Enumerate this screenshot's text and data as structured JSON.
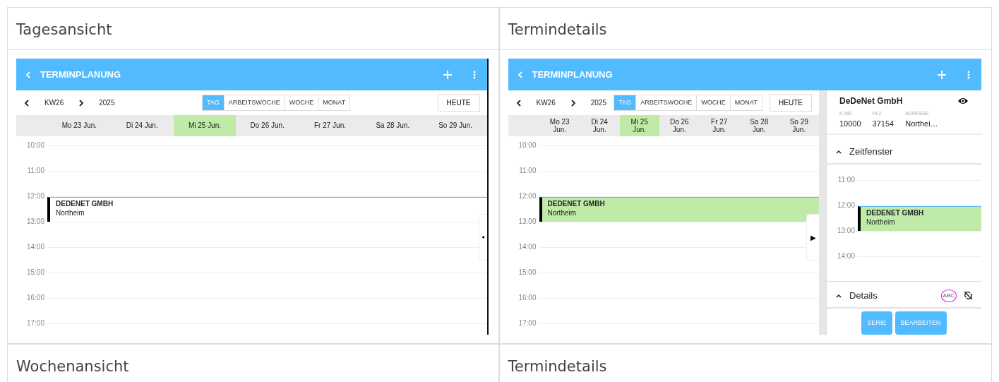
{
  "panels": [
    {
      "heading": "Tagesansicht",
      "app": {
        "title": "TERMINPLANUNG",
        "week": "KW26",
        "year": "2025",
        "views": [
          {
            "label": "TAG",
            "selected": true
          },
          {
            "label": "ARBEITSWOCHE",
            "selected": false
          },
          {
            "label": "WOCHE",
            "selected": false
          },
          {
            "label": "MONAT",
            "selected": false
          }
        ],
        "today": "HEUTE",
        "days": [
          {
            "label": "Mo 23 Jun.",
            "selected": false
          },
          {
            "label": "Di 24 Jun.",
            "selected": false
          },
          {
            "label": "Mi 25 Jun.",
            "selected": true
          },
          {
            "label": "Do 26 Jun.",
            "selected": false
          },
          {
            "label": "Fr 27 Jun.",
            "selected": false
          },
          {
            "label": "Sa 28 Jun.",
            "selected": false
          },
          {
            "label": "So 29 Jun.",
            "selected": false
          }
        ],
        "hours": [
          {
            "label": "10:00"
          },
          {
            "label": "11:00"
          },
          {
            "label": "12:00",
            "event": {
              "title": "DEDENET GMBH",
              "subtitle": "Northeim",
              "selected": false
            }
          },
          {
            "label": "13:00"
          },
          {
            "label": "14:00"
          },
          {
            "label": "15:00"
          },
          {
            "label": "16:00"
          },
          {
            "label": "17:00"
          }
        ],
        "drawer_toggle": "◂"
      }
    },
    {
      "heading": "Termindetails",
      "app": {
        "title": "TERMINPLANUNG",
        "week": "KW26",
        "year": "2025",
        "views": [
          {
            "label": "TAG",
            "selected": true
          },
          {
            "label": "ARBEITSWOCHE",
            "selected": false
          },
          {
            "label": "WOCHE",
            "selected": false
          },
          {
            "label": "MONAT",
            "selected": false
          }
        ],
        "today": "HEUTE",
        "days": [
          {
            "label": "Mo 23 Jun.",
            "selected": false
          },
          {
            "label": "Di 24 Jun.",
            "selected": false
          },
          {
            "label": "Mi 25 Jun.",
            "selected": true
          },
          {
            "label": "Do 26 Jun.",
            "selected": false
          },
          {
            "label": "Fr 27 Jun.",
            "selected": false
          },
          {
            "label": "Sa 28 Jun.",
            "selected": false
          },
          {
            "label": "So 29 Jun.",
            "selected": false
          }
        ],
        "hours": [
          {
            "label": "10:00"
          },
          {
            "label": "11:00"
          },
          {
            "label": "12:00",
            "event": {
              "title": "DEDENET GMBH",
              "subtitle": "Northeim",
              "selected": true
            }
          },
          {
            "label": "13:00"
          },
          {
            "label": "14:00"
          },
          {
            "label": "15:00"
          },
          {
            "label": "16:00"
          },
          {
            "label": "17:00"
          }
        ],
        "drawer_toggle": "▶",
        "details": {
          "company": "DeDeNet GmbH",
          "fields": [
            {
              "label": "K-NR.",
              "value": "10000"
            },
            {
              "label": "PLZ",
              "value": "37154"
            },
            {
              "label": "ADRESSE",
              "value": "Northei…"
            }
          ],
          "time_section": {
            "title": "Zeitfenster",
            "expanded": true,
            "hours": [
              {
                "label": "11:00"
              },
              {
                "label": "12:00",
                "event": {
                  "title": "DEDENET GMBH",
                  "subtitle": "Northeim",
                  "selected": true
                }
              },
              {
                "label": "13:00"
              },
              {
                "label": "14:00"
              }
            ]
          },
          "details_section": {
            "title": "Details",
            "expanded": true,
            "badge": "ABC"
          },
          "buttons": [
            "SERIE",
            "BEARBEITEN"
          ]
        }
      }
    }
  ],
  "next_headings": [
    "Wochenansicht",
    "Termindetails"
  ]
}
